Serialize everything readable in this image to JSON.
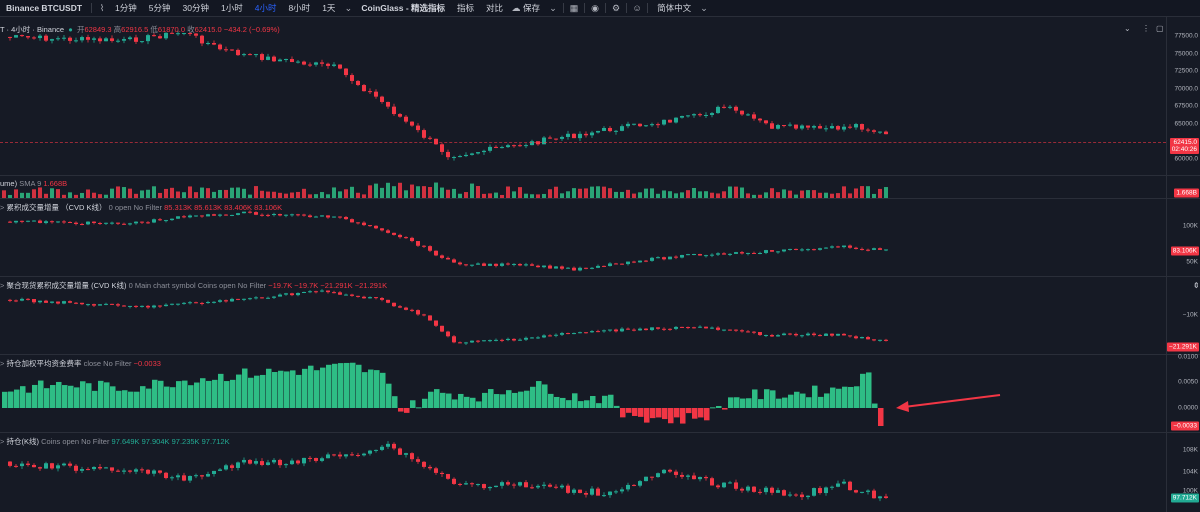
{
  "toolbar": {
    "symbol": "Binance BTCUSDT",
    "intervals": [
      "1分钟",
      "5分钟",
      "30分钟",
      "1小时",
      "4小时",
      "8小时",
      "1天"
    ],
    "active_interval": "4小时",
    "coinglass": "CoinGlass - 精选指标",
    "indicators": "指标",
    "compare": "对比",
    "save": "保存",
    "language": "简体中文"
  },
  "main_legend": {
    "title": "T · 4小时 · Binance",
    "open_label": "开",
    "open": "62849.3",
    "high_label": "高",
    "high": "62916.5",
    "low_label": "低",
    "low": "61870.0",
    "close_label": "收",
    "close": "62415.0",
    "change": "−434.2 (−0.69%)"
  },
  "main_axis": {
    "ticks": [
      "77500.0",
      "75000.0",
      "72500.0",
      "70000.0",
      "67500.0",
      "65000.0",
      "60000.0"
    ],
    "price_tag": "62415.0",
    "countdown": "02:40:26"
  },
  "volume": {
    "name": "ume)",
    "sma": "SMA 9",
    "value": "1.668B",
    "tag": "1.668B"
  },
  "cvd": {
    "name": "累积成交量增量 （CVD K线）",
    "params": "0 open No Filter",
    "values": "85.313K 85.613K 83.406K 83.106K",
    "ticks": [
      "100K",
      "50K"
    ],
    "tag": "83.106K"
  },
  "cvd_spot": {
    "name": "聚合现货累积成交量增量 (CVD K线)",
    "params": "0 Main chart symbol Coins open No Filter",
    "values": "−19.7K −19.7K −21.291K −21.291K",
    "ticks": [
      "0",
      "−10K"
    ],
    "tag": "−21.291K"
  },
  "funding": {
    "name": "持仓加权平均资金费率",
    "params": "close No Filter",
    "value": "−0.0033",
    "ticks": [
      "0.0100",
      "0.0050",
      "0.0000"
    ],
    "tag": "−0.0033"
  },
  "oi": {
    "name": "持仓(K线)",
    "params": "Coins open No Filter",
    "values": "97.649K 97.904K 97.235K 97.712K",
    "ticks": [
      "108K",
      "104K",
      "100K"
    ],
    "tag": "97.712K"
  },
  "colors": {
    "up": "#22ab94",
    "down": "#f23645",
    "bar_up": "#2ebd85",
    "bg": "#161a25",
    "arrow": "#f23645"
  }
}
